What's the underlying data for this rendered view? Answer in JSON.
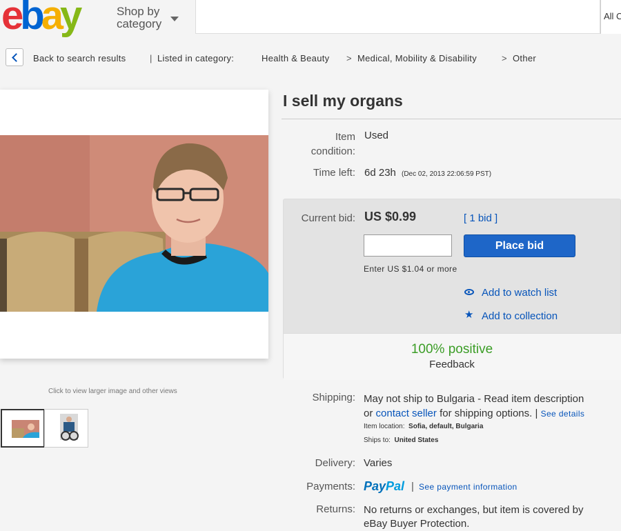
{
  "header": {
    "logo": {
      "e": "e",
      "b": "b",
      "a": "a",
      "y": "y"
    },
    "shop_by": "Shop by",
    "category": "category",
    "all_categories": "All C"
  },
  "breadcrumb": {
    "back": "Back to search results",
    "listed": "Listed in category:",
    "cat1": "Health & Beauty",
    "cat2": "Medical, Mobility & Disability",
    "cat3": "Other",
    "sep": ">",
    "bar": "|"
  },
  "gallery": {
    "hint": "Click to view larger image and other views"
  },
  "item": {
    "title": "I sell my organs",
    "condition_label_1": "Item",
    "condition_label_2": "condition:",
    "condition_value": "Used",
    "time_left_label": "Time left:",
    "time_left_value": "6d 23h",
    "time_left_date": "(Dec 02, 2013   22:06:59 PST)"
  },
  "bid": {
    "current_bid_label": "Current bid:",
    "price": "US $0.99",
    "bid_count": "[ 1 bid ]",
    "place_bid": "Place bid",
    "enter_hint": "Enter US $1.04 or more",
    "watch": "Add to watch list",
    "collection": "Add to collection",
    "positive": "100% positive",
    "feedback": "Feedback"
  },
  "shipping": {
    "label": "Shipping:",
    "line1": "May not ship to Bulgaria - Read item description",
    "line2_pre": "or",
    "contact": "contact seller",
    "line2_post": "for shipping options. |",
    "see_details": "See details",
    "location_label": "Item location:",
    "location_value": "Sofia, default, Bulgaria",
    "ships_label": "Ships to:",
    "ships_value": "United States"
  },
  "delivery": {
    "label": "Delivery:",
    "value": "Varies"
  },
  "payments": {
    "label": "Payments:",
    "pay": "Pay",
    "pal": "Pal",
    "bar": "|",
    "see_payment": "See payment information"
  },
  "returns": {
    "label": "Returns:",
    "line1": "No returns or exchanges, but item is covered by",
    "line2": "eBay Buyer Protection."
  },
  "colors": {
    "link": "#0654ba",
    "button": "#1e66c8",
    "positive": "#3b9d26"
  }
}
